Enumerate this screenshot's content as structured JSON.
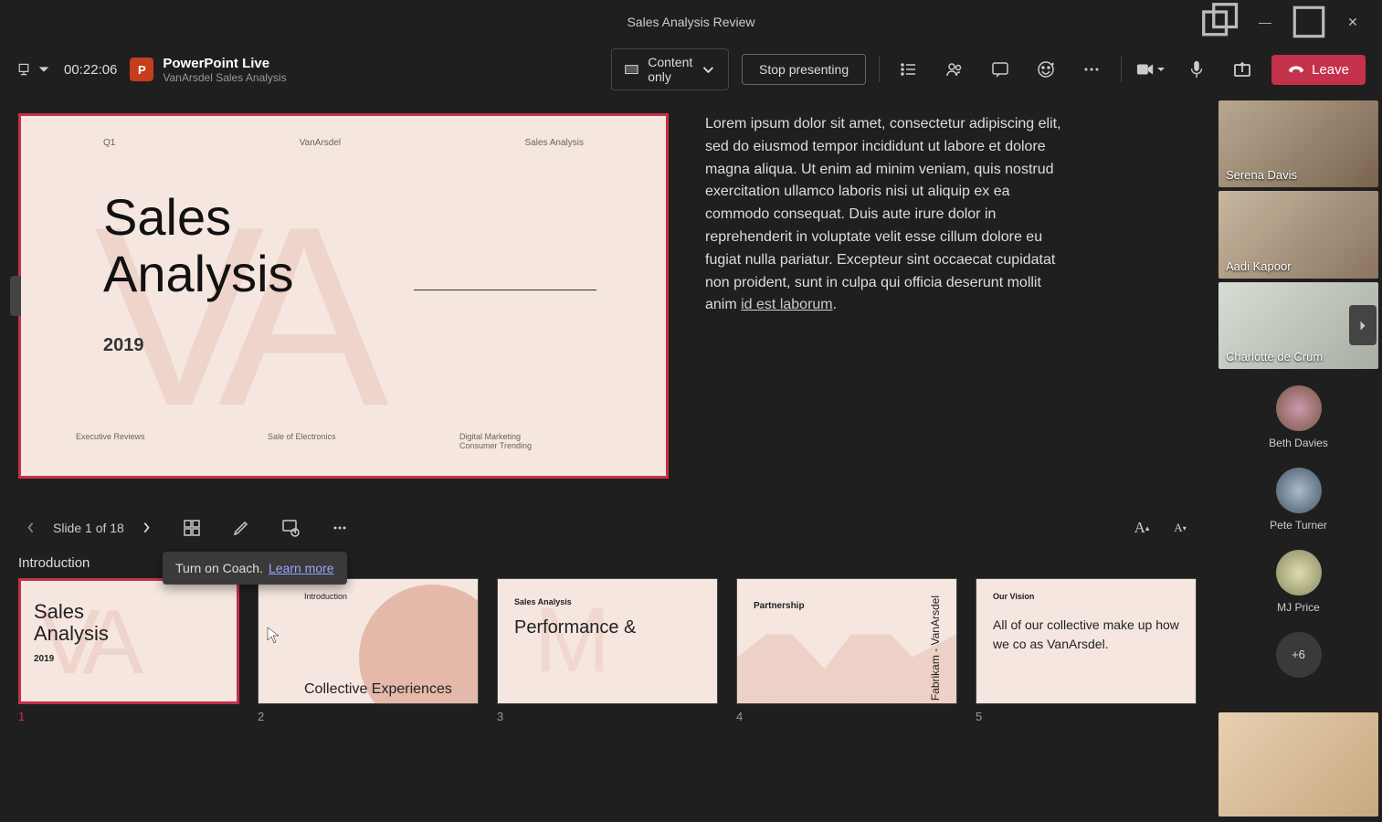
{
  "window": {
    "title": "Sales Analysis Review"
  },
  "toolbar": {
    "timer": "00:22:06",
    "app_name": "PowerPoint Live",
    "doc_name": "VanArsdel Sales Analysis",
    "content_mode": "Content only",
    "stop_presenting": "Stop presenting",
    "leave": "Leave"
  },
  "slide": {
    "q": "Q1",
    "brand": "VanArsdel",
    "sa": "Sales Analysis",
    "title_line1": "Sales",
    "title_line2": "Analysis",
    "year": "2019",
    "foot1": "Executive Reviews",
    "foot2": "Sale of Electronics",
    "foot3": "Digital Marketing Consumer Trending"
  },
  "coach": {
    "text": "Turn on Coach.",
    "link": "Learn more"
  },
  "notes": {
    "body": "Lorem ipsum dolor sit amet, consectetur adipiscing elit, sed do eiusmod tempor incididunt ut labore et dolore magna aliqua. Ut enim ad minim veniam, quis nostrud exercitation ullamco laboris nisi ut aliquip ex ea commodo consequat. Duis aute irure dolor in reprehenderit in voluptate velit esse cillum dolore eu fugiat nulla pariatur. Excepteur sint occaecat cupidatat non proident, sunt in culpa qui officia deserunt mollit anim ",
    "link": "id est laborum"
  },
  "pager": {
    "label": "Slide 1 of 18"
  },
  "section": {
    "label": "Introduction"
  },
  "thumbs": {
    "t1": {
      "title": "Sales\nAnalysis",
      "year": "2019",
      "num": "1"
    },
    "t2": {
      "intro": "Introduction",
      "ce": "Collective Experiences",
      "num": "2"
    },
    "t3": {
      "sa": "Sales Analysis",
      "pf": "Performance &",
      "num": "3"
    },
    "t4": {
      "pt": "Partnership",
      "fv": "Fabrikam - VanArsdel",
      "num": "4"
    },
    "t5": {
      "ov": "Our Vision",
      "body": "All of our collective make up how we co as VanArsdel.",
      "num": "5"
    }
  },
  "participants": {
    "video": [
      {
        "name": "Serena Davis"
      },
      {
        "name": "Aadi Kapoor"
      },
      {
        "name": "Charlotte de Crum"
      }
    ],
    "avatars": [
      {
        "name": "Beth Davies"
      },
      {
        "name": "Pete Turner"
      },
      {
        "name": "MJ Price"
      }
    ],
    "more": "+6"
  }
}
